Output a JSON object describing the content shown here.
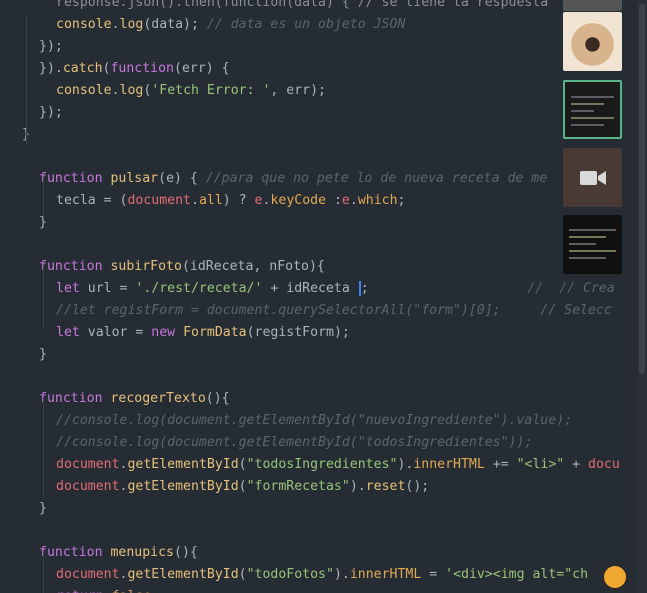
{
  "editor": {
    "lines": [
      {
        "indent": 2,
        "tokens": [
          [
            "t-dim",
            "response.json().then(function(data) { // se tiene la respuesta"
          ]
        ]
      },
      {
        "indent": 2,
        "tokens": [
          [
            "t-fn",
            "console"
          ],
          [
            "t-pun",
            "."
          ],
          [
            "t-fn",
            "log"
          ],
          [
            "t-pun",
            "(data); "
          ],
          [
            "t-com",
            "// data es un objeto JSON"
          ]
        ]
      },
      {
        "indent": 1,
        "tokens": [
          [
            "t-pun",
            "});"
          ]
        ]
      },
      {
        "indent": 1,
        "tokens": [
          [
            "t-pun",
            "})."
          ],
          [
            "t-fn",
            "catch"
          ],
          [
            "t-pun",
            "("
          ],
          [
            "t-kw",
            "function"
          ],
          [
            "t-pun",
            "(err) {"
          ]
        ]
      },
      {
        "indent": 2,
        "tokens": [
          [
            "t-fn",
            "console"
          ],
          [
            "t-pun",
            "."
          ],
          [
            "t-fn",
            "log"
          ],
          [
            "t-pun",
            "("
          ],
          [
            "t-str",
            "'Fetch Error: '"
          ],
          [
            "t-pun",
            ", err);"
          ]
        ]
      },
      {
        "indent": 1,
        "tokens": [
          [
            "t-pun",
            "});"
          ]
        ]
      },
      {
        "indent": 0,
        "tokens": [
          [
            "t-pun",
            "}"
          ]
        ]
      },
      {
        "indent": 0,
        "tokens": []
      },
      {
        "indent": 1,
        "tokens": [
          [
            "t-kw",
            "function"
          ],
          [
            "t-pun",
            " "
          ],
          [
            "t-fn",
            "pulsar"
          ],
          [
            "t-pun",
            "(e) { "
          ],
          [
            "t-com",
            "//para que no pete lo de nueva receta de me"
          ]
        ]
      },
      {
        "indent": 2,
        "tokens": [
          [
            "t-pun",
            "tecla = ("
          ],
          [
            "t-obj",
            "document"
          ],
          [
            "t-pun",
            "."
          ],
          [
            "t-prop",
            "all"
          ],
          [
            "t-pun",
            ") ? "
          ],
          [
            "t-obj",
            "e"
          ],
          [
            "t-pun",
            "."
          ],
          [
            "t-prop",
            "keyCode"
          ],
          [
            "t-pun",
            " :"
          ],
          [
            "t-obj",
            "e"
          ],
          [
            "t-pun",
            "."
          ],
          [
            "t-prop",
            "which"
          ],
          [
            "t-pun",
            ";"
          ]
        ]
      },
      {
        "indent": 1,
        "tokens": [
          [
            "t-pun",
            "}"
          ]
        ]
      },
      {
        "indent": 0,
        "tokens": []
      },
      {
        "indent": 1,
        "tokens": [
          [
            "t-kw",
            "function"
          ],
          [
            "t-pun",
            " "
          ],
          [
            "t-fn",
            "subirFoto"
          ],
          [
            "t-pun",
            "(idReceta, nFoto){"
          ]
        ]
      },
      {
        "indent": 2,
        "cursor": true,
        "tokens": [
          [
            "t-kw",
            "let"
          ],
          [
            "t-pun",
            " url = "
          ],
          [
            "t-str",
            "'./rest/receta/'"
          ],
          [
            "t-pun",
            " + idReceta "
          ]
        ],
        "after": [
          [
            "t-pun",
            ";                    "
          ],
          [
            "t-com",
            "//  // Crea"
          ]
        ]
      },
      {
        "indent": 2,
        "tokens": [
          [
            "t-com",
            "//let registForm = document.querySelectorAll(\"form\")[0];     // Selecc"
          ]
        ]
      },
      {
        "indent": 2,
        "tokens": [
          [
            "t-kw",
            "let"
          ],
          [
            "t-pun",
            " valor = "
          ],
          [
            "t-kw",
            "new"
          ],
          [
            "t-pun",
            " "
          ],
          [
            "t-fn",
            "FormData"
          ],
          [
            "t-pun",
            "(registForm);"
          ]
        ]
      },
      {
        "indent": 1,
        "tokens": [
          [
            "t-pun",
            "}"
          ]
        ]
      },
      {
        "indent": 0,
        "tokens": []
      },
      {
        "indent": 1,
        "tokens": [
          [
            "t-kw",
            "function"
          ],
          [
            "t-pun",
            " "
          ],
          [
            "t-fn",
            "recogerTexto"
          ],
          [
            "t-pun",
            "(){"
          ]
        ]
      },
      {
        "indent": 2,
        "tokens": [
          [
            "t-com",
            "//console.log(document.getElementById(\"nuevoIngrediente\").value);"
          ]
        ]
      },
      {
        "indent": 2,
        "tokens": [
          [
            "t-com",
            "//console.log(document.getElementById(\"todosIngredientes\"));"
          ]
        ]
      },
      {
        "indent": 2,
        "tokens": [
          [
            "t-obj",
            "document"
          ],
          [
            "t-pun",
            "."
          ],
          [
            "t-fn",
            "getElementById"
          ],
          [
            "t-pun",
            "("
          ],
          [
            "t-str",
            "\"todosIngredientes\""
          ],
          [
            "t-pun",
            ")."
          ],
          [
            "t-prop",
            "innerHTML"
          ],
          [
            "t-pun",
            " += "
          ],
          [
            "t-str",
            "\"<li>\""
          ],
          [
            "t-pun",
            " + "
          ],
          [
            "t-obj",
            "docu"
          ]
        ]
      },
      {
        "indent": 2,
        "tokens": [
          [
            "t-obj",
            "document"
          ],
          [
            "t-pun",
            "."
          ],
          [
            "t-fn",
            "getElementById"
          ],
          [
            "t-pun",
            "("
          ],
          [
            "t-str",
            "\"formRecetas\""
          ],
          [
            "t-pun",
            ")."
          ],
          [
            "t-fn",
            "reset"
          ],
          [
            "t-pun",
            "();"
          ]
        ]
      },
      {
        "indent": 1,
        "tokens": [
          [
            "t-pun",
            "}"
          ]
        ]
      },
      {
        "indent": 0,
        "tokens": []
      },
      {
        "indent": 1,
        "tokens": [
          [
            "t-kw",
            "function"
          ],
          [
            "t-pun",
            " "
          ],
          [
            "t-fn",
            "menupics"
          ],
          [
            "t-pun",
            "(){"
          ]
        ]
      },
      {
        "indent": 2,
        "tokens": [
          [
            "t-obj",
            "document"
          ],
          [
            "t-pun",
            "."
          ],
          [
            "t-fn",
            "getElementById"
          ],
          [
            "t-pun",
            "("
          ],
          [
            "t-str",
            "\"todoFotos\""
          ],
          [
            "t-pun",
            ")."
          ],
          [
            "t-prop",
            "innerHTML"
          ],
          [
            "t-pun",
            " = "
          ],
          [
            "t-str",
            "'<div><img alt=\"ch"
          ]
        ]
      },
      {
        "indent": 2,
        "tokens": [
          [
            "t-kw",
            "return"
          ],
          [
            "t-pun",
            " "
          ],
          [
            "t-num",
            "false"
          ],
          [
            "t-pun",
            ";"
          ]
        ]
      }
    ]
  },
  "thumbnails": [
    {
      "name": "thumb-partial",
      "color": "#555555"
    },
    {
      "name": "thumb-dog-photo",
      "color": "#c9a07a"
    },
    {
      "name": "thumb-code-window",
      "color": "#1a1a1a",
      "active": true
    },
    {
      "name": "thumb-video-camera",
      "color": "#4a3a36",
      "icon": "video-camera-icon"
    },
    {
      "name": "thumb-editor-screen",
      "color": "#101010"
    }
  ],
  "colors": {
    "background": "#262c34",
    "accent_active": "#58b58a",
    "cursor": "#3b82f6"
  }
}
